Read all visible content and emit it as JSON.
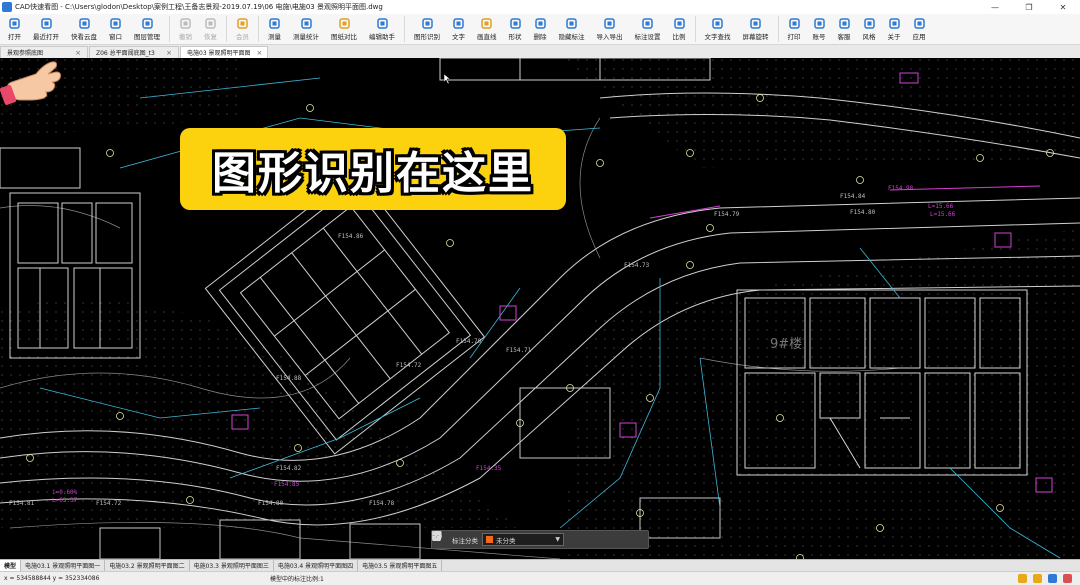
{
  "window": {
    "title": "CAD快速看图 - C:\\Users\\glodon\\Desktop\\案例工程\\王备志景观-2019.07.19\\06 电施\\电施03 景观照明平面图.dwg",
    "minimize": "—",
    "maximize": "❐",
    "close": "✕"
  },
  "toolbar": {
    "items": [
      {
        "label": "打开",
        "icon": "folder-icon",
        "color": "#2f78d3",
        "enabled": true
      },
      {
        "label": "最近打开",
        "icon": "clock-icon",
        "color": "#2f78d3",
        "enabled": true
      },
      {
        "label": "快看云盘",
        "icon": "cloud-icon",
        "color": "#2f78d3",
        "enabled": true
      },
      {
        "label": "窗口",
        "icon": "window-icon",
        "color": "#2f78d3",
        "enabled": true
      },
      {
        "label": "图层管理",
        "icon": "layers-icon",
        "color": "#2f78d3",
        "enabled": true
      },
      {
        "label": "撤销",
        "icon": "undo-icon",
        "color": "#bbbbbb",
        "enabled": false
      },
      {
        "label": "恢复",
        "icon": "redo-icon",
        "color": "#bbbbbb",
        "enabled": false
      },
      {
        "label": "会员",
        "icon": "vip-icon",
        "color": "#e0a020",
        "enabled": false
      },
      {
        "label": "测量",
        "icon": "measure-icon",
        "color": "#2f78d3",
        "enabled": true
      },
      {
        "label": "测量统计",
        "icon": "measure-stats-icon",
        "color": "#2f78d3",
        "enabled": true
      },
      {
        "label": "图纸对比",
        "icon": "compare-icon",
        "color": "#e0a020",
        "enabled": true
      },
      {
        "label": "编辑助手",
        "icon": "edit-assistant-icon",
        "color": "#2f78d3",
        "enabled": true
      },
      {
        "label": "图形识别",
        "icon": "shape-recognize-icon",
        "color": "#2f78d3",
        "enabled": true
      },
      {
        "label": "文字",
        "icon": "text-icon",
        "color": "#2f78d3",
        "enabled": true
      },
      {
        "label": "画直线",
        "icon": "line-icon",
        "color": "#e0a020",
        "enabled": true
      },
      {
        "label": "形状",
        "icon": "shape-icon",
        "color": "#2f78d3",
        "enabled": true
      },
      {
        "label": "删除",
        "icon": "eraser-icon",
        "color": "#2f78d3",
        "enabled": true
      },
      {
        "label": "隐藏标注",
        "icon": "hide-annotation-icon",
        "color": "#2f78d3",
        "enabled": true
      },
      {
        "label": "导入导出",
        "icon": "import-export-icon",
        "color": "#2f78d3",
        "enabled": true
      },
      {
        "label": "标注设置",
        "icon": "annotation-settings-icon",
        "color": "#2f78d3",
        "enabled": true
      },
      {
        "label": "比例",
        "icon": "scale-icon",
        "color": "#2f78d3",
        "enabled": true
      },
      {
        "label": "文字查找",
        "icon": "text-search-icon",
        "color": "#2f78d3",
        "enabled": true
      },
      {
        "label": "屏幕旋转",
        "icon": "rotate-icon",
        "color": "#2f78d3",
        "enabled": true
      },
      {
        "label": "打印",
        "icon": "print-icon",
        "color": "#2f78d3",
        "enabled": true
      },
      {
        "label": "账号",
        "icon": "account-icon",
        "color": "#2f78d3",
        "enabled": true
      },
      {
        "label": "客服",
        "icon": "headset-icon",
        "color": "#2f78d3",
        "enabled": true
      },
      {
        "label": "风格",
        "icon": "style-icon",
        "color": "#2f78d3",
        "enabled": true
      },
      {
        "label": "关于",
        "icon": "info-icon",
        "color": "#2f78d3",
        "enabled": true
      },
      {
        "label": "应用",
        "icon": "apps-icon",
        "color": "#2f78d3",
        "enabled": true
      }
    ]
  },
  "doc_tabs": [
    {
      "label": "景观参照底图",
      "active": false
    },
    {
      "label": "Z06 总平面阈底图_t3",
      "active": false
    },
    {
      "label": "电施03 景观照明平面图",
      "active": true
    }
  ],
  "callout": {
    "text": "图形识别在这里",
    "background": "#fcd20e"
  },
  "pointer": {
    "icon": "pointing-hand-icon"
  },
  "cad_labels": {
    "elev_f1": "F154.84",
    "elev_f2": "F154.86",
    "elev_f3": "F154.79",
    "elev_f4": "F154.80",
    "elev_f5": "F154.73",
    "elev_f6": "F154.70",
    "elev_f7": "F154.71",
    "elev_f8": "F154.72",
    "elev_f9": "F154.82",
    "elev_f10": "F154.85",
    "elev_f11": "F154.80",
    "elev_f12": "F154.72",
    "elev_f13": "F154.81",
    "elev_f14": "F154.78",
    "elev_f15": "F154.88",
    "slope1": "i=0.60%",
    "slope2": "L=63.37",
    "slope3": "L=15.66",
    "slope4": "L=15.66",
    "elev_m1": "F154.98",
    "elev_m2": "F154.35",
    "note_9": "9#楼"
  },
  "floatbar": {
    "label": "标注分类",
    "selected": "未分类",
    "swatch": "#f06a1a",
    "tools": [
      "edit-icon",
      "move-icon",
      "copy-icon",
      "paste-icon"
    ]
  },
  "layout_tabs": [
    {
      "label": "模型",
      "active": true
    },
    {
      "label": "电施03.1 景观照明平面图一",
      "active": false
    },
    {
      "label": "电施03.2 景观照明平面图二",
      "active": false
    },
    {
      "label": "电施03.3 景观照明平面图三",
      "active": false
    },
    {
      "label": "电施03.4 景观照明平面图四",
      "active": false
    },
    {
      "label": "电施03.5 景观照明平面图五",
      "active": false
    }
  ],
  "status": {
    "coords": "x = 534588844  y = 352334086",
    "message": "模型中的标注比例:1",
    "icons": [
      {
        "name": "folder-status-icon",
        "color": "#e8a818"
      },
      {
        "name": "share-status-icon",
        "color": "#e8a818"
      },
      {
        "name": "grid-status-icon",
        "color": "#2f78d3"
      },
      {
        "name": "skin-status-icon",
        "color": "#d85050"
      }
    ]
  }
}
